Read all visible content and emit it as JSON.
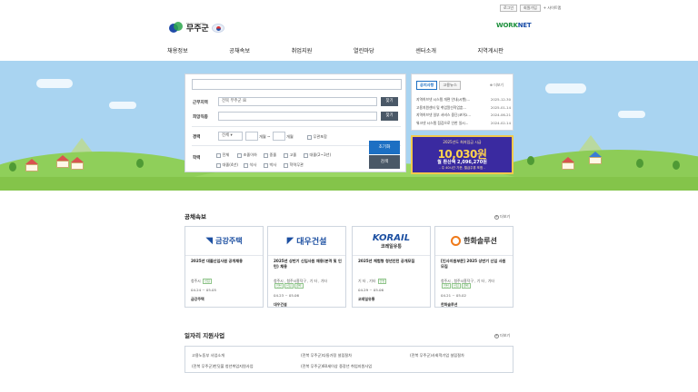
{
  "util": {
    "login": "로그인",
    "join": "회원가입",
    "sitemap": "+ 사이트맵"
  },
  "header": {
    "logo_en": "MUJU COUNTY",
    "logo_ko": "무주군",
    "worknet": "WORK",
    "worknet2": "NET"
  },
  "gnb": [
    "채용정보",
    "공채속보",
    "취업지원",
    "열린마당",
    "센터소개",
    "지역게시판"
  ],
  "search": {
    "area_label": "근무지역",
    "area_value": "전북 무주군 ☒",
    "find1": "찾기",
    "job_label": "희망직종",
    "find2": "찾기",
    "career_label": "경력",
    "career_select": "전체",
    "months": "개월 ~",
    "months2": "개월",
    "no_career": "무관포함",
    "edu_label": "학력",
    "edu": [
      "전체",
      "초졸이하",
      "중졸",
      "고졸",
      "대졸(2~3년)",
      "대졸(4년)",
      "석사",
      "박사",
      "학력무관"
    ],
    "reset": "초기화",
    "go": "검색"
  },
  "notice": {
    "tabs": [
      "공지사항",
      "고용뉴스"
    ],
    "more": "더보기",
    "items": [
      {
        "title": "지역허브넷 시스템 개편 안내(시행)...",
        "date": "2025-12-30"
      },
      {
        "title": "고용지원센터 및 취업알선직업훈...",
        "date": "2025-01-14"
      },
      {
        "title": "지역허브넷 일부 서비스 중단(코어2...",
        "date": "2024-06-21"
      },
      {
        "title": "워크넷 시스템 점검으로 인한 일시...",
        "date": "2024-02-14"
      }
    ]
  },
  "banner": {
    "line1": "2025년도 최저임금 시급",
    "amount": "10,030원",
    "line3": "월 환산액 2,096,270원",
    "line4": "- 주 40시간 기준, 월급주휴 포함 -"
  },
  "section1": {
    "title": "공채속보",
    "more": "더보기"
  },
  "cards": [
    {
      "logo": "금강주택",
      "title": "2025년 대졸신입사원 공개채용",
      "loc": "청주시",
      "tag": "신입",
      "date": "04.24 ~ 05.05",
      "name": "금강주택"
    },
    {
      "logo": "대우건설",
      "title": "2025년 상반기 신입사원 채용(본격 및 인턴) 채용",
      "loc": "청주시 , 청주시흥덕구 , 기 타 , 기타",
      "tags": [
        "인턴",
        "신입",
        "경력"
      ],
      "date": "04.23 ~ 05.06",
      "name": "대우건설"
    },
    {
      "logo": "KORAIL",
      "logo2": "코레일유통",
      "title": "2025년 체험형 청년인턴 공개모집",
      "loc": "기 타 , 기타",
      "tag": "인턴",
      "date": "04.29 ~ 05.06",
      "name": "코레일유통"
    },
    {
      "logo": "한화솔루션",
      "title": "[인사지원부문] 2025 상반기 신입 사원 모집",
      "loc": "청주시 , 청주시흥덕구 , 기 타 , 기타",
      "tags": [
        "인턴",
        "신입",
        "경력"
      ],
      "date": "04.21 ~ 05.02",
      "name": "한화솔루션"
    }
  ],
  "section2": {
    "title": "일자리 지원사업",
    "more": "더보기"
  },
  "jobs": [
    "고용노동부 사업소개",
    "(전북 무주군)다둥가정 설립절차",
    "(전북 무주군)사회적기업 설립절차",
    "(전북 무주군)반딧불 청년취업지원사업",
    "(전북 무주군)60세이상 중장년 취업지원사업"
  ],
  "colors": {
    "hero_sky": "#a9d4f1",
    "accent": "#1c6fc3",
    "grass": "#84c44a"
  }
}
